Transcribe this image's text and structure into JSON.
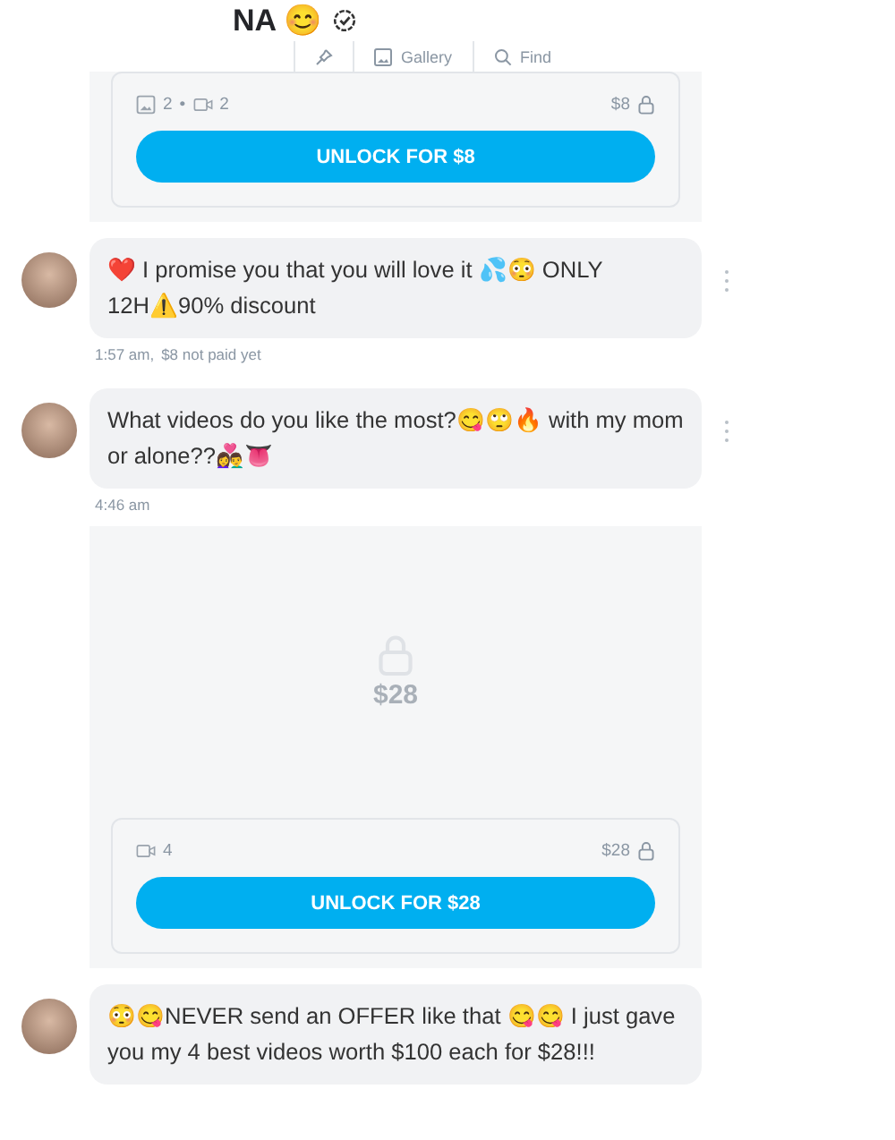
{
  "header": {
    "title": "NA 😊",
    "verified": true,
    "toolbar": [
      {
        "kind": "pin"
      },
      {
        "kind": "gallery",
        "label": "Gallery"
      },
      {
        "kind": "find",
        "label": "Find"
      }
    ]
  },
  "messages": [
    {
      "kind": "locked",
      "counts": [
        {
          "kind": "photo",
          "count": "2"
        },
        {
          "kind": "video",
          "count": "2"
        }
      ],
      "count_separator": "•",
      "price": "$8",
      "button": "UNLOCK FOR $8"
    },
    {
      "kind": "text",
      "text": "❤️ I promise you that you will love it 💦😳 ONLY 12H⚠️90% discount",
      "avatar": true,
      "menu": true
    },
    {
      "kind": "time",
      "text": "1:57 am,",
      "note": "$8 not paid yet"
    },
    {
      "kind": "text",
      "text": "What videos do you like the most?😋🙄🔥 with my mom or alone??👩‍❤️‍👨👅",
      "avatar": true,
      "menu": true
    },
    {
      "kind": "time",
      "text": "4:46 am"
    },
    {
      "kind": "locked",
      "preview_price": "$28",
      "counts": [
        {
          "kind": "video",
          "count": "4"
        }
      ],
      "price": "$28",
      "button": "UNLOCK FOR $28"
    },
    {
      "kind": "text",
      "text": "😳😋NEVER send an OFFER like that 😋😋 I just gave you my 4 best videos worth $100 each for $28!!!",
      "avatar": true,
      "menu": false
    }
  ]
}
